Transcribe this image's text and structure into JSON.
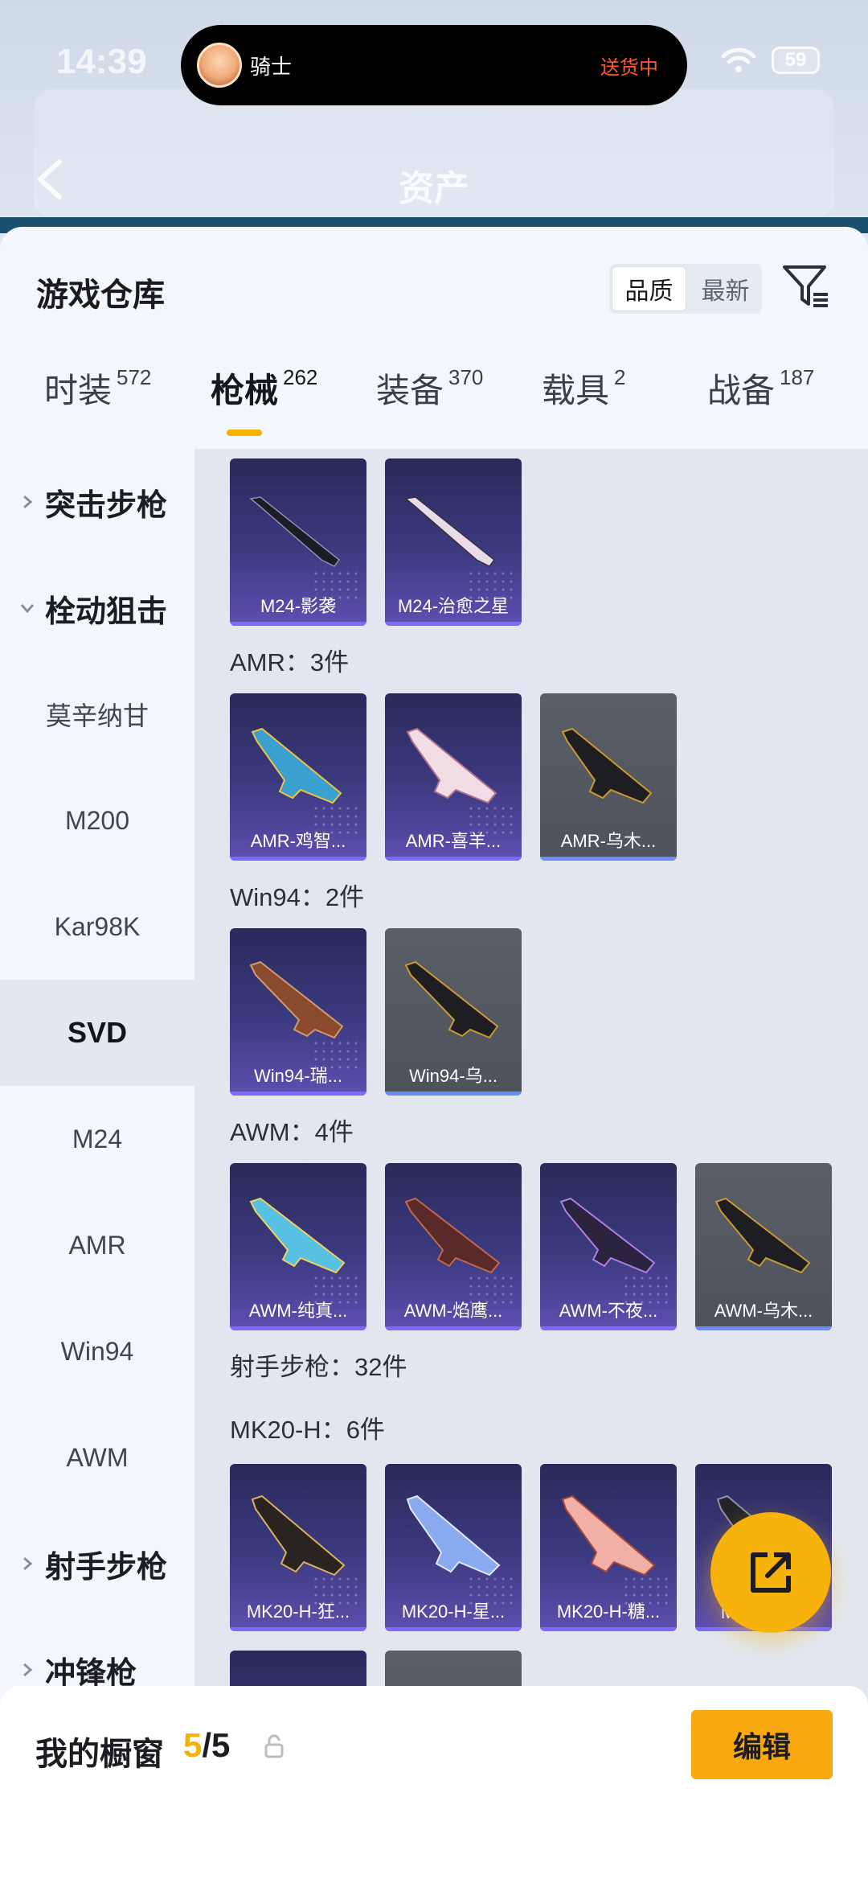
{
  "status_bar": {
    "time": "14:39",
    "battery": "59"
  },
  "live_activity": {
    "name": "骑士",
    "status": "送货中"
  },
  "header": {
    "title": "资产"
  },
  "warehouse": {
    "title": "游戏仓库",
    "sort_options": [
      "品质",
      "最新"
    ],
    "sort_active": "品质",
    "categories": [
      {
        "label": "时装",
        "count": "572"
      },
      {
        "label": "枪械",
        "count": "262",
        "active": true
      },
      {
        "label": "装备",
        "count": "370"
      },
      {
        "label": "载具",
        "count": "2"
      },
      {
        "label": "战备",
        "count": "187"
      }
    ]
  },
  "sidebar": {
    "groups": [
      {
        "label": "突击步枪",
        "expanded": false
      },
      {
        "label": "栓动狙击",
        "expanded": true
      },
      {
        "label": "射手步枪",
        "expanded": false
      },
      {
        "label": "冲锋枪",
        "expanded": false
      }
    ],
    "items": [
      "莫辛纳甘",
      "M200",
      "Kar98K",
      "SVD",
      "M24",
      "AMR",
      "Win94",
      "AWM"
    ],
    "active_item": "SVD"
  },
  "content": {
    "sections": [
      {
        "label": "AMR：3件"
      },
      {
        "label": "Win94：2件"
      },
      {
        "label": "AWM：4件"
      },
      {
        "label": "射手步枪：32件"
      },
      {
        "label": "MK20-H：6件"
      }
    ],
    "cards": {
      "m24": [
        "M24-影袭",
        "M24-治愈之星"
      ],
      "amr": [
        "AMR-鸡智...",
        "AMR-喜羊...",
        "AMR-乌木..."
      ],
      "win94": [
        "Win94-瑞...",
        "Win94-乌..."
      ],
      "awm": [
        "AWM-纯真...",
        "AWM-焰鹰...",
        "AWM-不夜...",
        "AWM-乌木..."
      ],
      "mk20": [
        "MK20-H-狂...",
        "MK20-H-星...",
        "MK20-H-糖...",
        "MK20-H-..."
      ]
    }
  },
  "footer": {
    "showcase_label": "我的橱窗",
    "showcase_current": "5",
    "showcase_total": "/5",
    "edit_label": "编辑"
  },
  "colors": {
    "accent": "#f7a90f",
    "card_purple": "#3c3a80",
    "card_grey": "#53575f"
  }
}
